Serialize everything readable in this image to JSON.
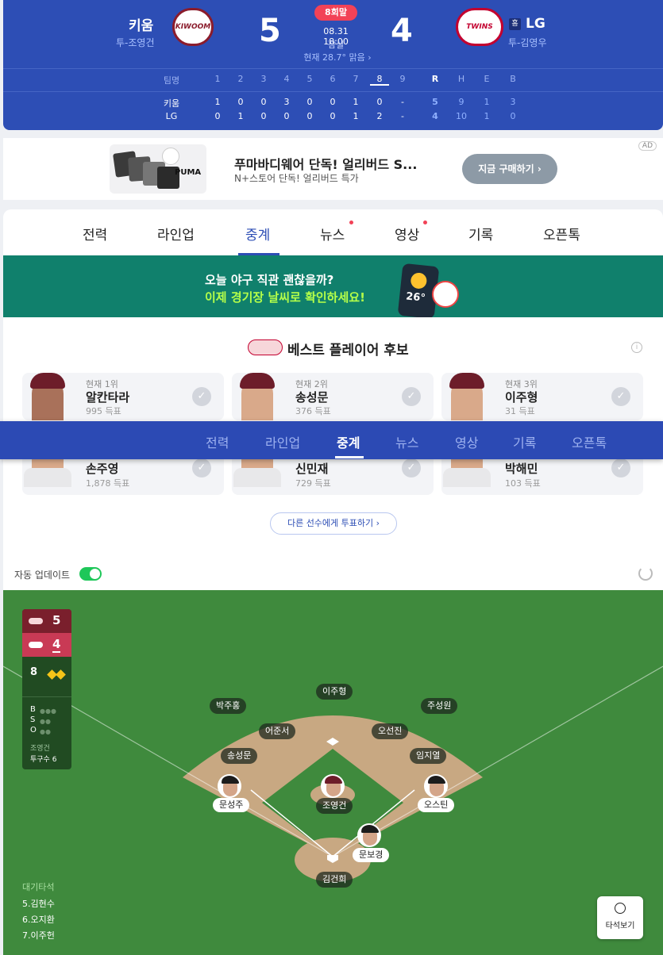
{
  "game": {
    "away": {
      "name": "키움",
      "pitcher": "투-조영건",
      "score": "5",
      "logo": "KIWOOM",
      "logo_color": "#8b1c2c"
    },
    "home": {
      "name": "LG",
      "pitcher": "투-김영우",
      "score": "4",
      "home_badge": "홈",
      "logo": "TWINS",
      "logo_color": "#c3002f"
    },
    "inning": "8회말",
    "datetime": "08.31 18:00",
    "stadium": "잠실",
    "weather": "현재 28.7° 맑음 ›"
  },
  "boxscore": {
    "headers": [
      "팀명",
      "1",
      "2",
      "3",
      "4",
      "5",
      "6",
      "7",
      "8",
      "9",
      "R",
      "H",
      "E",
      "B"
    ],
    "rows": [
      {
        "team": "키움",
        "cells": [
          "1",
          "0",
          "0",
          "3",
          "0",
          "0",
          "1",
          "0",
          "-",
          "5",
          "9",
          "1",
          "3"
        ]
      },
      {
        "team": "LG",
        "cells": [
          "0",
          "1",
          "0",
          "0",
          "0",
          "0",
          "1",
          "2",
          "-",
          "4",
          "10",
          "1",
          "0"
        ]
      }
    ]
  },
  "ad": {
    "badge": "AD",
    "title": "푸마바디웨어 단독! 얼리버드 S...",
    "subtitle": "N+스토어 단독! 얼리버드 특가",
    "cta": "지금 구매하기 ›",
    "brand": "PUMA"
  },
  "tabs": [
    "전력",
    "라인업",
    "중계",
    "뉴스",
    "영상",
    "기록",
    "오픈톡"
  ],
  "active_tab": "중계",
  "banner": {
    "line1": "오늘 야구 직관 괜찮을까?",
    "line2": "이제 경기장 날씨로 확인하세요!",
    "temp": "26°"
  },
  "mvp": {
    "title": "베스트 플레이어 후보",
    "players": [
      {
        "rank": "현재 1위",
        "name": "알칸타라",
        "votes": "995 득표"
      },
      {
        "rank": "현재 2위",
        "name": "송성문",
        "votes": "376 득표"
      },
      {
        "rank": "현재 3위",
        "name": "이주형",
        "votes": "31 득표"
      },
      {
        "rank": "",
        "name": "손주영",
        "votes": "1,878 득표"
      },
      {
        "rank": "",
        "name": "신민재",
        "votes": "729 득표"
      },
      {
        "rank": "",
        "name": "박해민",
        "votes": "103 득표"
      }
    ],
    "vote_button": "다른 선수에게 투표하기 ›"
  },
  "auto_update": {
    "label": "자동 업데이트",
    "on": true
  },
  "scorebox": {
    "away_score": "5",
    "home_score": "4",
    "inning": "8",
    "bso": [
      "B",
      "S",
      "O"
    ],
    "pitcher": "조영건",
    "pitch_count": "투구수 6"
  },
  "fielders": {
    "cf": "이주형",
    "lf": "박주홍",
    "rf": "주성원",
    "ss": "어준서",
    "second": "오선진",
    "third": "송성문",
    "first": "임지열",
    "pitcher": "조영건",
    "catcher": "김건희"
  },
  "runners": {
    "third": "문성주",
    "first": "오스틴",
    "batter": "문보경"
  },
  "waiting": {
    "title": "대기타석",
    "list": [
      "5.김현수",
      "6.오지환",
      "7.이주헌"
    ]
  },
  "pitch_view": "타석보기",
  "colors": {
    "primary": "#2d4eb5",
    "accent": "#f24257",
    "field": "#3f8a3d",
    "infield": "#c8a882"
  }
}
